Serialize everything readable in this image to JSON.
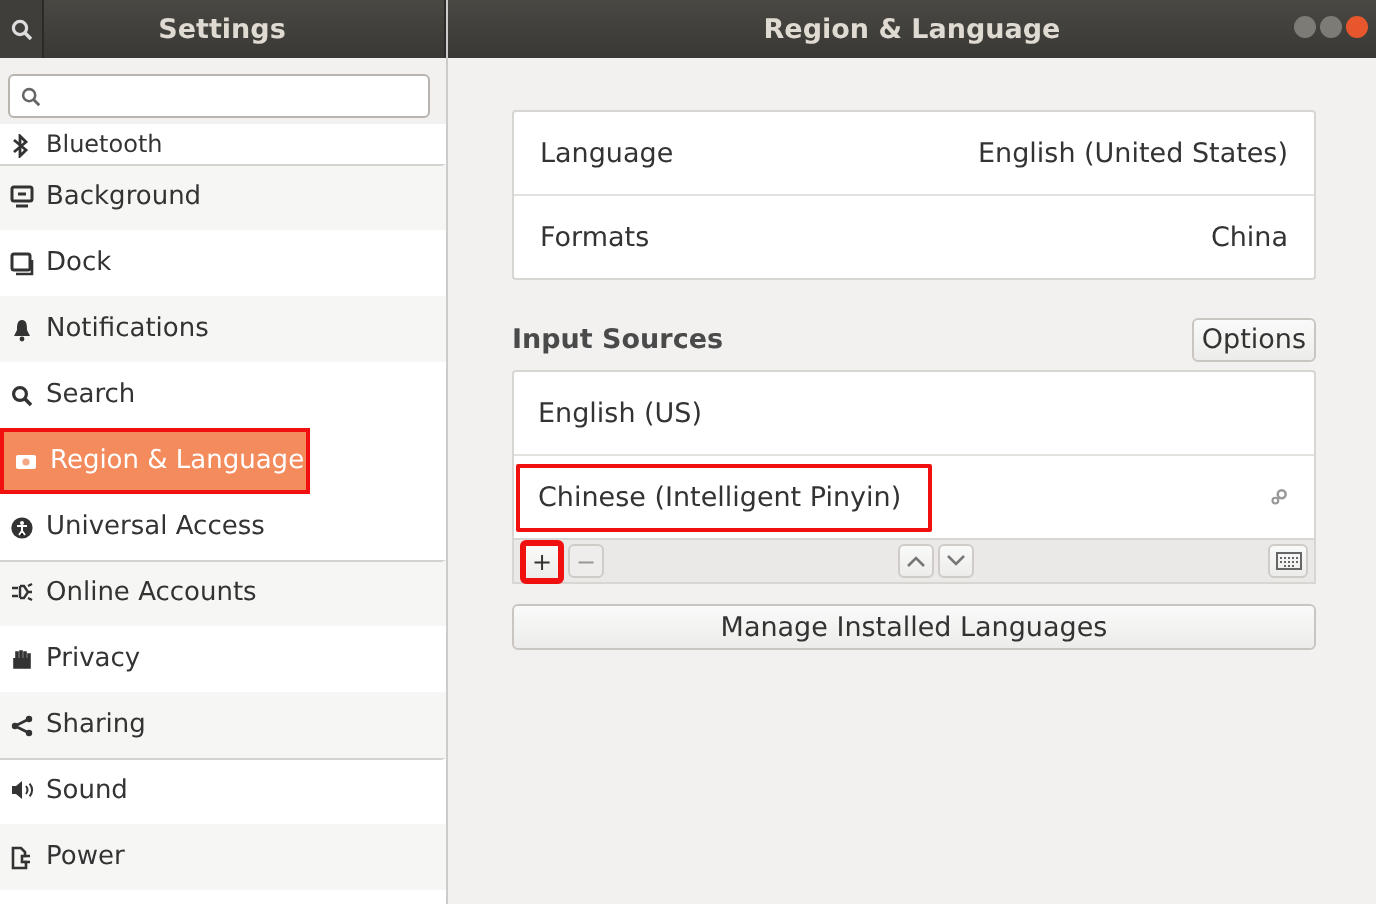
{
  "sidebar": {
    "title": "Settings",
    "items": [
      {
        "label": "Bluetooth",
        "selected": false,
        "highlighted": false,
        "separator_above": false
      },
      {
        "label": "Background",
        "selected": false,
        "highlighted": false,
        "separator_above": true
      },
      {
        "label": "Dock",
        "selected": false,
        "highlighted": false,
        "separator_above": false
      },
      {
        "label": "Notifications",
        "selected": false,
        "highlighted": false,
        "separator_above": false
      },
      {
        "label": "Search",
        "selected": false,
        "highlighted": false,
        "separator_above": false
      },
      {
        "label": "Region & Language",
        "selected": true,
        "highlighted": true,
        "separator_above": false
      },
      {
        "label": "Universal Access",
        "selected": false,
        "highlighted": false,
        "separator_above": false
      },
      {
        "label": "Online Accounts",
        "selected": false,
        "highlighted": false,
        "separator_above": true
      },
      {
        "label": "Privacy",
        "selected": false,
        "highlighted": false,
        "separator_above": false
      },
      {
        "label": "Sharing",
        "selected": false,
        "highlighted": false,
        "separator_above": false
      },
      {
        "label": "Sound",
        "selected": false,
        "highlighted": false,
        "separator_above": true
      },
      {
        "label": "Power",
        "selected": false,
        "highlighted": false,
        "separator_above": false
      }
    ]
  },
  "window": {
    "title": "Region & Language"
  },
  "settings": [
    {
      "label": "Language",
      "value": "English (United States)"
    },
    {
      "label": "Formats",
      "value": "China"
    }
  ],
  "input_sources": {
    "title": "Input Sources",
    "options_button": "Options",
    "sources": [
      {
        "label": "English (US)",
        "highlighted": false,
        "has_settings": false
      },
      {
        "label": "Chinese (Intelligent Pinyin)",
        "highlighted": true,
        "has_settings": true
      }
    ],
    "add_button": {
      "label": "+",
      "highlighted": true
    },
    "remove_button": {
      "label": "−",
      "disabled": true
    }
  },
  "manage_button": "Manage Installed Languages"
}
